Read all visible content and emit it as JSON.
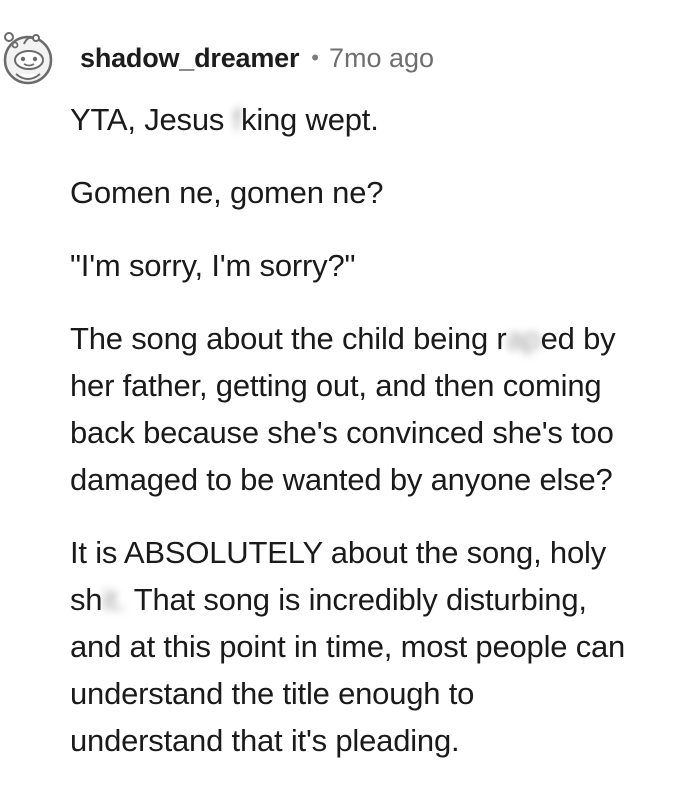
{
  "comment": {
    "avatar_icon": "snoo-avatar-icon",
    "username": "shadow_dreamer",
    "separator": "•",
    "timestamp": "7mo ago",
    "paragraphs": [
      {
        "lines": [
          {
            "a": "YTA, Jesus ",
            "redacted": "f",
            "b": "king wept."
          }
        ]
      },
      {
        "lines": [
          {
            "a": "Gomen ne, gomen ne?"
          }
        ]
      },
      {
        "lines": [
          {
            "a": "\"I'm sorry, I'm sorry?\""
          }
        ]
      },
      {
        "lines": [
          {
            "a": "The song about the child being r",
            "redacted": "ap",
            "b": "ed by"
          },
          {
            "a": "her father, getting out, and then coming"
          },
          {
            "a": "back because she's convinced she's too"
          },
          {
            "a": "damaged to be wanted by anyone else?"
          }
        ]
      },
      {
        "lines": [
          {
            "a": "It is ABSOLUTELY about the song, holy"
          },
          {
            "a": "sh",
            "redacted": "it.",
            "b": " That song is incredibly disturbing,"
          },
          {
            "a": "and at this point in time, most people can"
          },
          {
            "a": "understand the title enough to"
          },
          {
            "a": "understand that it's pleading."
          }
        ]
      }
    ]
  }
}
